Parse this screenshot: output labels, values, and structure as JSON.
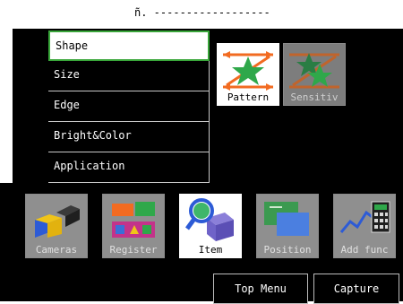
{
  "window": {
    "title": "ñ. ------------------"
  },
  "menu": {
    "items": [
      {
        "label": "Shape",
        "selected": true
      },
      {
        "label": "Size",
        "selected": false
      },
      {
        "label": "Edge",
        "selected": false
      },
      {
        "label": "Bright&Color",
        "selected": false
      },
      {
        "label": "Application",
        "selected": false
      }
    ]
  },
  "patterns": {
    "items": [
      {
        "label": "Pattern",
        "icon": "pattern-icon"
      },
      {
        "label": "Sensitiv",
        "icon": "sensitivity-icon"
      }
    ]
  },
  "toolbar": {
    "items": [
      {
        "label": "Cameras",
        "icon": "camera-icon"
      },
      {
        "label": "Register",
        "icon": "register-icon"
      },
      {
        "label": "Item",
        "icon": "magnifier-item-icon",
        "active": true
      },
      {
        "label": "Position",
        "icon": "position-icon"
      },
      {
        "label": "Add func",
        "icon": "calculator-icon"
      }
    ]
  },
  "actions": {
    "top_menu_label": "Top Menu",
    "capture_label": "Capture"
  },
  "colors": {
    "panel_bg": "#000000",
    "selected_border": "#39a63a",
    "accent_orange": "#f26b21",
    "accent_green": "#2fa84a",
    "tile_gray": "#8f8f8f"
  }
}
